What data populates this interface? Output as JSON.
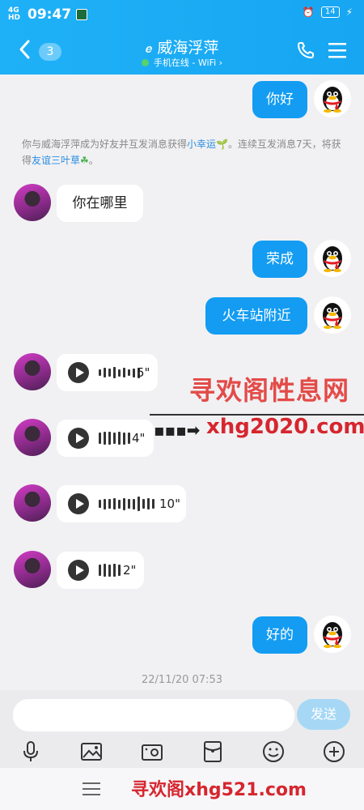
{
  "status_bar": {
    "network": "4G HD",
    "time": "09:47",
    "battery": "14"
  },
  "header": {
    "back_count": "3",
    "contact_name": "威海浮萍",
    "status_text": "手机在线 - WiFi",
    "status_suffix": "›"
  },
  "messages": {
    "m1": "你好",
    "system_notice": {
      "part1": "你与威海浮萍成为好友并互发消息获得",
      "link1": "小幸运",
      "part2": "。连续互发消息7天，将获得",
      "link2": "友谊三叶草",
      "part3": "。"
    },
    "m2": "你在哪里",
    "m3": "荣成",
    "m4": "火车站附近",
    "voice1_duration": "5\"",
    "voice2_duration": "4\"",
    "voice3_duration": "10\"",
    "voice4_duration": "2\"",
    "m5": "好的",
    "timestamp": "22/11/20 07:53"
  },
  "watermarks": {
    "w1": "寻欢阁性息网",
    "w2": "xhg2020.com",
    "w3": "寻欢阁xhg521.com"
  },
  "composer": {
    "input_value": "",
    "send_label": "发送"
  },
  "colors": {
    "accent": "#139cf2",
    "header_bg": "#1fb1f7",
    "send_disabled": "#a6d8f6"
  }
}
